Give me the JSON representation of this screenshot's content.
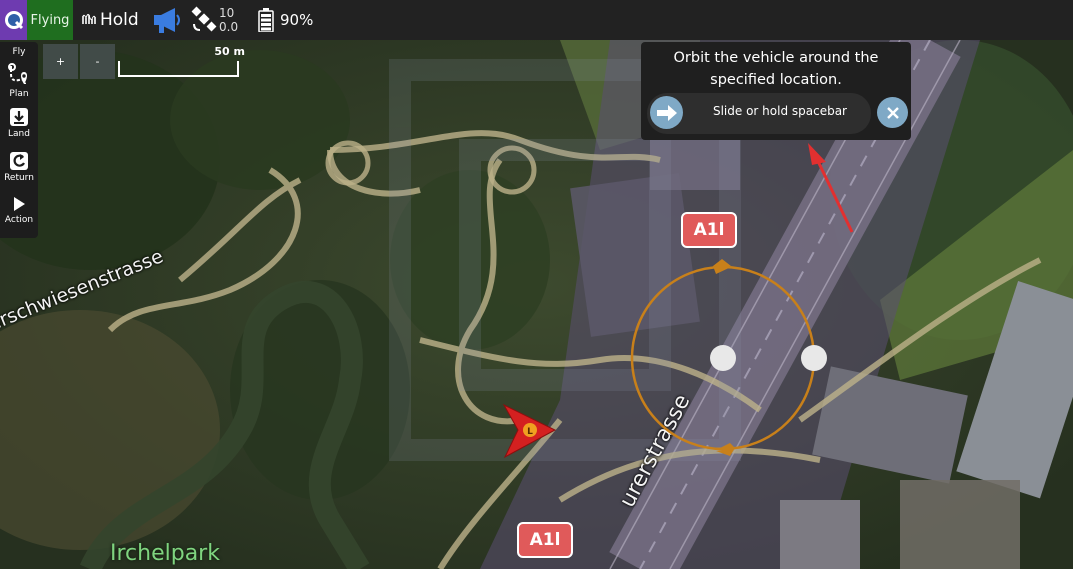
{
  "toolbar": {
    "flight_state": "Flying",
    "flight_mode": "Hold",
    "gps_satellites": "10",
    "gps_hdop": "0.0",
    "battery": "90%",
    "icons": [
      "qgc-logo-icon",
      "mode-waveform-icon",
      "megaphone-icon",
      "satellite-icon",
      "battery-icon"
    ],
    "colors": {
      "flying_bg": "#1f6e1f",
      "logo_bg": "#6e3bb0",
      "megaphone": "#3a7ce0"
    }
  },
  "tools": [
    {
      "id": "fly",
      "label": "Fly"
    },
    {
      "id": "plan",
      "label": "Plan",
      "icon": "plan-route-icon"
    },
    {
      "id": "land",
      "label": "Land",
      "icon": "land-icon"
    },
    {
      "id": "return",
      "label": "Return",
      "icon": "return-icon"
    },
    {
      "id": "action",
      "label": "Action",
      "icon": "play-icon"
    }
  ],
  "map": {
    "zoom_in": "+",
    "zoom_out": "-",
    "scale": "50 m",
    "street_labels": [
      "Hirschwiesenstrasse",
      "urerstrasse"
    ],
    "park_label": "Irchelpark",
    "highway_shields": [
      "A1l",
      "A1l"
    ],
    "vehicle_marker_label": "L",
    "orbit_color": "#c8801a"
  },
  "guided_action": {
    "message": "Orbit the vehicle around the specified location.",
    "slider_text": "Slide or hold spacebar",
    "cancel_icon": "close-icon",
    "slider_icon": "arrow-right-icon",
    "accent": "#7fa9c6"
  }
}
